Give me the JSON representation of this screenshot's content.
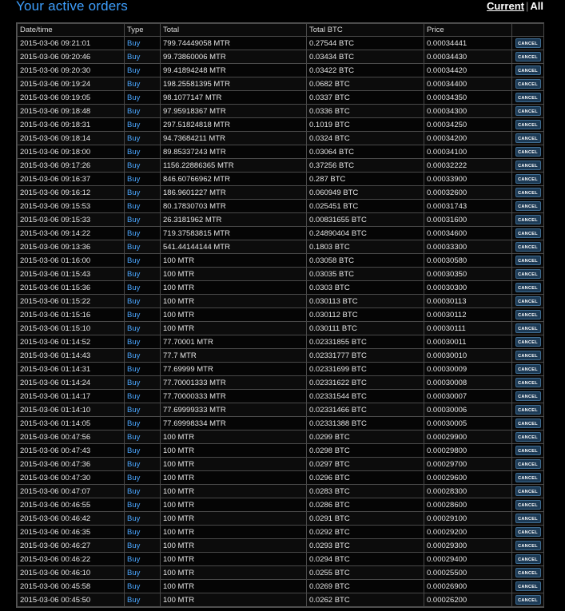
{
  "header": {
    "title": "Your active orders",
    "filter_current": "Current",
    "filter_separator": "|",
    "filter_all": "All"
  },
  "table": {
    "columns": [
      "Date/time",
      "Type",
      "Total",
      "Total BTC",
      "Price",
      ""
    ],
    "cancel_label": "CANCEL",
    "rows": [
      {
        "date": "2015-03-06 09:21:01",
        "type": "Buy",
        "total": "799.74449058 MTR",
        "total_btc": "0.27544 BTC",
        "price": "0.00034441"
      },
      {
        "date": "2015-03-06 09:20:46",
        "type": "Buy",
        "total": "99.73860006 MTR",
        "total_btc": "0.03434 BTC",
        "price": "0.00034430"
      },
      {
        "date": "2015-03-06 09:20:30",
        "type": "Buy",
        "total": "99.41894248 MTR",
        "total_btc": "0.03422 BTC",
        "price": "0.00034420"
      },
      {
        "date": "2015-03-06 09:19:24",
        "type": "Buy",
        "total": "198.25581395 MTR",
        "total_btc": "0.0682 BTC",
        "price": "0.00034400"
      },
      {
        "date": "2015-03-06 09:19:05",
        "type": "Buy",
        "total": "98.1077147 MTR",
        "total_btc": "0.0337 BTC",
        "price": "0.00034350"
      },
      {
        "date": "2015-03-06 09:18:48",
        "type": "Buy",
        "total": "97.95918367 MTR",
        "total_btc": "0.0336 BTC",
        "price": "0.00034300"
      },
      {
        "date": "2015-03-06 09:18:31",
        "type": "Buy",
        "total": "297.51824818 MTR",
        "total_btc": "0.1019 BTC",
        "price": "0.00034250"
      },
      {
        "date": "2015-03-06 09:18:14",
        "type": "Buy",
        "total": "94.73684211 MTR",
        "total_btc": "0.0324 BTC",
        "price": "0.00034200"
      },
      {
        "date": "2015-03-06 09:18:00",
        "type": "Buy",
        "total": "89.85337243 MTR",
        "total_btc": "0.03064 BTC",
        "price": "0.00034100"
      },
      {
        "date": "2015-03-06 09:17:26",
        "type": "Buy",
        "total": "1156.22886365 MTR",
        "total_btc": "0.37256 BTC",
        "price": "0.00032222"
      },
      {
        "date": "2015-03-06 09:16:37",
        "type": "Buy",
        "total": "846.60766962 MTR",
        "total_btc": "0.287 BTC",
        "price": "0.00033900"
      },
      {
        "date": "2015-03-06 09:16:12",
        "type": "Buy",
        "total": "186.9601227 MTR",
        "total_btc": "0.060949 BTC",
        "price": "0.00032600"
      },
      {
        "date": "2015-03-06 09:15:53",
        "type": "Buy",
        "total": "80.17830703 MTR",
        "total_btc": "0.025451 BTC",
        "price": "0.00031743"
      },
      {
        "date": "2015-03-06 09:15:33",
        "type": "Buy",
        "total": "26.3181962 MTR",
        "total_btc": "0.00831655 BTC",
        "price": "0.00031600"
      },
      {
        "date": "2015-03-06 09:14:22",
        "type": "Buy",
        "total": "719.37583815 MTR",
        "total_btc": "0.24890404 BTC",
        "price": "0.00034600"
      },
      {
        "date": "2015-03-06 09:13:36",
        "type": "Buy",
        "total": "541.44144144 MTR",
        "total_btc": "0.1803 BTC",
        "price": "0.00033300"
      },
      {
        "date": "2015-03-06 01:16:00",
        "type": "Buy",
        "total": "100 MTR",
        "total_btc": "0.03058 BTC",
        "price": "0.00030580"
      },
      {
        "date": "2015-03-06 01:15:43",
        "type": "Buy",
        "total": "100 MTR",
        "total_btc": "0.03035 BTC",
        "price": "0.00030350"
      },
      {
        "date": "2015-03-06 01:15:36",
        "type": "Buy",
        "total": "100 MTR",
        "total_btc": "0.0303 BTC",
        "price": "0.00030300"
      },
      {
        "date": "2015-03-06 01:15:22",
        "type": "Buy",
        "total": "100 MTR",
        "total_btc": "0.030113 BTC",
        "price": "0.00030113"
      },
      {
        "date": "2015-03-06 01:15:16",
        "type": "Buy",
        "total": "100 MTR",
        "total_btc": "0.030112 BTC",
        "price": "0.00030112"
      },
      {
        "date": "2015-03-06 01:15:10",
        "type": "Buy",
        "total": "100 MTR",
        "total_btc": "0.030111 BTC",
        "price": "0.00030111"
      },
      {
        "date": "2015-03-06 01:14:52",
        "type": "Buy",
        "total": "77.70001 MTR",
        "total_btc": "0.02331855 BTC",
        "price": "0.00030011"
      },
      {
        "date": "2015-03-06 01:14:43",
        "type": "Buy",
        "total": "77.7 MTR",
        "total_btc": "0.02331777 BTC",
        "price": "0.00030010"
      },
      {
        "date": "2015-03-06 01:14:31",
        "type": "Buy",
        "total": "77.69999 MTR",
        "total_btc": "0.02331699 BTC",
        "price": "0.00030009"
      },
      {
        "date": "2015-03-06 01:14:24",
        "type": "Buy",
        "total": "77.70001333 MTR",
        "total_btc": "0.02331622 BTC",
        "price": "0.00030008"
      },
      {
        "date": "2015-03-06 01:14:17",
        "type": "Buy",
        "total": "77.70000333 MTR",
        "total_btc": "0.02331544 BTC",
        "price": "0.00030007"
      },
      {
        "date": "2015-03-06 01:14:10",
        "type": "Buy",
        "total": "77.69999333 MTR",
        "total_btc": "0.02331466 BTC",
        "price": "0.00030006"
      },
      {
        "date": "2015-03-06 01:14:05",
        "type": "Buy",
        "total": "77.69998334 MTR",
        "total_btc": "0.02331388 BTC",
        "price": "0.00030005"
      },
      {
        "date": "2015-03-06 00:47:56",
        "type": "Buy",
        "total": "100 MTR",
        "total_btc": "0.0299 BTC",
        "price": "0.00029900"
      },
      {
        "date": "2015-03-06 00:47:43",
        "type": "Buy",
        "total": "100 MTR",
        "total_btc": "0.0298 BTC",
        "price": "0.00029800"
      },
      {
        "date": "2015-03-06 00:47:36",
        "type": "Buy",
        "total": "100 MTR",
        "total_btc": "0.0297 BTC",
        "price": "0.00029700"
      },
      {
        "date": "2015-03-06 00:47:30",
        "type": "Buy",
        "total": "100 MTR",
        "total_btc": "0.0296 BTC",
        "price": "0.00029600"
      },
      {
        "date": "2015-03-06 00:47:07",
        "type": "Buy",
        "total": "100 MTR",
        "total_btc": "0.0283 BTC",
        "price": "0.00028300"
      },
      {
        "date": "2015-03-06 00:46:55",
        "type": "Buy",
        "total": "100 MTR",
        "total_btc": "0.0286 BTC",
        "price": "0.00028600"
      },
      {
        "date": "2015-03-06 00:46:42",
        "type": "Buy",
        "total": "100 MTR",
        "total_btc": "0.0291 BTC",
        "price": "0.00029100"
      },
      {
        "date": "2015-03-06 00:46:35",
        "type": "Buy",
        "total": "100 MTR",
        "total_btc": "0.0292 BTC",
        "price": "0.00029200"
      },
      {
        "date": "2015-03-06 00:46:27",
        "type": "Buy",
        "total": "100 MTR",
        "total_btc": "0.0293 BTC",
        "price": "0.00029300"
      },
      {
        "date": "2015-03-06 00:46:22",
        "type": "Buy",
        "total": "100 MTR",
        "total_btc": "0.0294 BTC",
        "price": "0.00029400"
      },
      {
        "date": "2015-03-06 00:46:10",
        "type": "Buy",
        "total": "100 MTR",
        "total_btc": "0.0255 BTC",
        "price": "0.00025500"
      },
      {
        "date": "2015-03-06 00:45:58",
        "type": "Buy",
        "total": "100 MTR",
        "total_btc": "0.0269 BTC",
        "price": "0.00026900"
      },
      {
        "date": "2015-03-06 00:45:50",
        "type": "Buy",
        "total": "100 MTR",
        "total_btc": "0.0262 BTC",
        "price": "0.00026200"
      }
    ]
  }
}
